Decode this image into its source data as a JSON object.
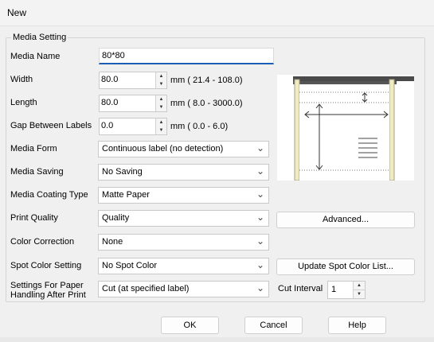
{
  "window": {
    "title": "New"
  },
  "group": {
    "label": "Media Setting"
  },
  "media_name": {
    "label": "Media Name",
    "value": "80*80"
  },
  "width": {
    "label": "Width",
    "value": "80.0",
    "range": "mm ( 21.4 - 108.0)"
  },
  "length": {
    "label": "Length",
    "value": "80.0",
    "range": "mm (  8.0 - 3000.0)"
  },
  "gap": {
    "label": "Gap Between Labels",
    "value": "0.0",
    "range": "mm (  0.0 -   6.0)"
  },
  "media_form": {
    "label": "Media Form",
    "value": "Continuous label (no detection)"
  },
  "media_saving": {
    "label": "Media Saving",
    "value": "No Saving"
  },
  "media_coating": {
    "label": "Media Coating Type",
    "value": "Matte Paper"
  },
  "print_quality": {
    "label": "Print Quality",
    "value": "Quality"
  },
  "color_correction": {
    "label": "Color Correction",
    "value": "None"
  },
  "spot_color": {
    "label": "Spot Color Setting",
    "value": "No Spot Color"
  },
  "paper_handling": {
    "label_line1": "Settings For Paper",
    "label_line2": "Handling After Print",
    "value": "Cut (at specified label)"
  },
  "cut_interval": {
    "label": "Cut Interval",
    "value": "1"
  },
  "buttons": {
    "advanced": "Advanced...",
    "update_spot": "Update Spot Color List...",
    "ok": "OK",
    "cancel": "Cancel",
    "help": "Help"
  },
  "icons": {
    "dropdown": "chevron-down-icon",
    "spin_up": "spin-up-icon",
    "spin_down": "spin-down-icon"
  },
  "colors": {
    "accent": "#1b5fb4",
    "window_bg": "#f0f0f0"
  }
}
